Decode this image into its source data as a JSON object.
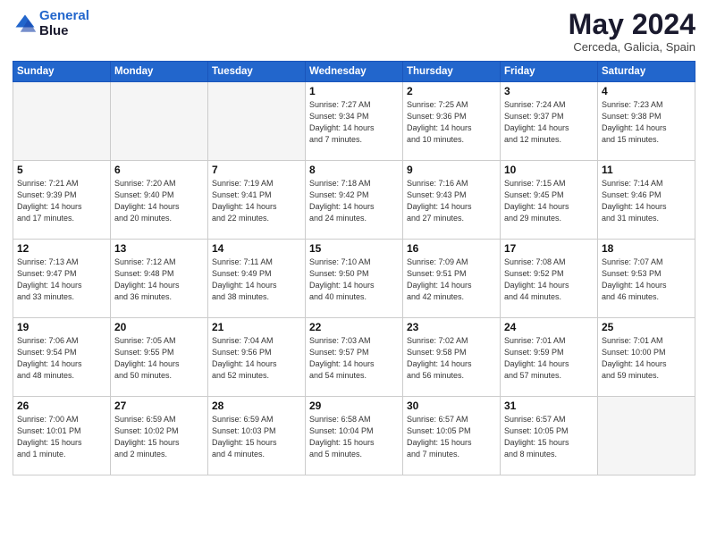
{
  "header": {
    "logo_line1": "General",
    "logo_line2": "Blue",
    "month": "May 2024",
    "location": "Cerceda, Galicia, Spain"
  },
  "weekdays": [
    "Sunday",
    "Monday",
    "Tuesday",
    "Wednesday",
    "Thursday",
    "Friday",
    "Saturday"
  ],
  "weeks": [
    [
      {
        "day": "",
        "info": ""
      },
      {
        "day": "",
        "info": ""
      },
      {
        "day": "",
        "info": ""
      },
      {
        "day": "1",
        "info": "Sunrise: 7:27 AM\nSunset: 9:34 PM\nDaylight: 14 hours\nand 7 minutes."
      },
      {
        "day": "2",
        "info": "Sunrise: 7:25 AM\nSunset: 9:36 PM\nDaylight: 14 hours\nand 10 minutes."
      },
      {
        "day": "3",
        "info": "Sunrise: 7:24 AM\nSunset: 9:37 PM\nDaylight: 14 hours\nand 12 minutes."
      },
      {
        "day": "4",
        "info": "Sunrise: 7:23 AM\nSunset: 9:38 PM\nDaylight: 14 hours\nand 15 minutes."
      }
    ],
    [
      {
        "day": "5",
        "info": "Sunrise: 7:21 AM\nSunset: 9:39 PM\nDaylight: 14 hours\nand 17 minutes."
      },
      {
        "day": "6",
        "info": "Sunrise: 7:20 AM\nSunset: 9:40 PM\nDaylight: 14 hours\nand 20 minutes."
      },
      {
        "day": "7",
        "info": "Sunrise: 7:19 AM\nSunset: 9:41 PM\nDaylight: 14 hours\nand 22 minutes."
      },
      {
        "day": "8",
        "info": "Sunrise: 7:18 AM\nSunset: 9:42 PM\nDaylight: 14 hours\nand 24 minutes."
      },
      {
        "day": "9",
        "info": "Sunrise: 7:16 AM\nSunset: 9:43 PM\nDaylight: 14 hours\nand 27 minutes."
      },
      {
        "day": "10",
        "info": "Sunrise: 7:15 AM\nSunset: 9:45 PM\nDaylight: 14 hours\nand 29 minutes."
      },
      {
        "day": "11",
        "info": "Sunrise: 7:14 AM\nSunset: 9:46 PM\nDaylight: 14 hours\nand 31 minutes."
      }
    ],
    [
      {
        "day": "12",
        "info": "Sunrise: 7:13 AM\nSunset: 9:47 PM\nDaylight: 14 hours\nand 33 minutes."
      },
      {
        "day": "13",
        "info": "Sunrise: 7:12 AM\nSunset: 9:48 PM\nDaylight: 14 hours\nand 36 minutes."
      },
      {
        "day": "14",
        "info": "Sunrise: 7:11 AM\nSunset: 9:49 PM\nDaylight: 14 hours\nand 38 minutes."
      },
      {
        "day": "15",
        "info": "Sunrise: 7:10 AM\nSunset: 9:50 PM\nDaylight: 14 hours\nand 40 minutes."
      },
      {
        "day": "16",
        "info": "Sunrise: 7:09 AM\nSunset: 9:51 PM\nDaylight: 14 hours\nand 42 minutes."
      },
      {
        "day": "17",
        "info": "Sunrise: 7:08 AM\nSunset: 9:52 PM\nDaylight: 14 hours\nand 44 minutes."
      },
      {
        "day": "18",
        "info": "Sunrise: 7:07 AM\nSunset: 9:53 PM\nDaylight: 14 hours\nand 46 minutes."
      }
    ],
    [
      {
        "day": "19",
        "info": "Sunrise: 7:06 AM\nSunset: 9:54 PM\nDaylight: 14 hours\nand 48 minutes."
      },
      {
        "day": "20",
        "info": "Sunrise: 7:05 AM\nSunset: 9:55 PM\nDaylight: 14 hours\nand 50 minutes."
      },
      {
        "day": "21",
        "info": "Sunrise: 7:04 AM\nSunset: 9:56 PM\nDaylight: 14 hours\nand 52 minutes."
      },
      {
        "day": "22",
        "info": "Sunrise: 7:03 AM\nSunset: 9:57 PM\nDaylight: 14 hours\nand 54 minutes."
      },
      {
        "day": "23",
        "info": "Sunrise: 7:02 AM\nSunset: 9:58 PM\nDaylight: 14 hours\nand 56 minutes."
      },
      {
        "day": "24",
        "info": "Sunrise: 7:01 AM\nSunset: 9:59 PM\nDaylight: 14 hours\nand 57 minutes."
      },
      {
        "day": "25",
        "info": "Sunrise: 7:01 AM\nSunset: 10:00 PM\nDaylight: 14 hours\nand 59 minutes."
      }
    ],
    [
      {
        "day": "26",
        "info": "Sunrise: 7:00 AM\nSunset: 10:01 PM\nDaylight: 15 hours\nand 1 minute."
      },
      {
        "day": "27",
        "info": "Sunrise: 6:59 AM\nSunset: 10:02 PM\nDaylight: 15 hours\nand 2 minutes."
      },
      {
        "day": "28",
        "info": "Sunrise: 6:59 AM\nSunset: 10:03 PM\nDaylight: 15 hours\nand 4 minutes."
      },
      {
        "day": "29",
        "info": "Sunrise: 6:58 AM\nSunset: 10:04 PM\nDaylight: 15 hours\nand 5 minutes."
      },
      {
        "day": "30",
        "info": "Sunrise: 6:57 AM\nSunset: 10:05 PM\nDaylight: 15 hours\nand 7 minutes."
      },
      {
        "day": "31",
        "info": "Sunrise: 6:57 AM\nSunset: 10:05 PM\nDaylight: 15 hours\nand 8 minutes."
      },
      {
        "day": "",
        "info": ""
      }
    ]
  ]
}
